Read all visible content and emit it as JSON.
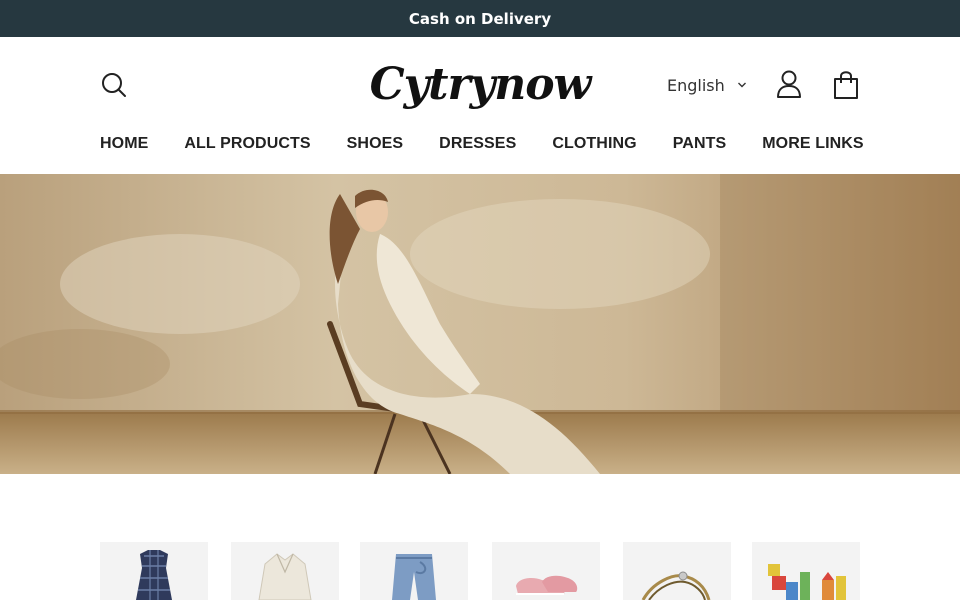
{
  "announcement": {
    "text": "Cash on Delivery"
  },
  "header": {
    "logo_text": "Cytrynow",
    "language": "English",
    "icons": {
      "search": "search-icon",
      "account": "user-icon",
      "cart": "shopping-bag-icon",
      "dropdown": "chevron-down-icon"
    }
  },
  "nav": {
    "items": [
      "HOME",
      "ALL PRODUCTS",
      "SHOES",
      "DRESSES",
      "CLOTHING",
      "PANTS",
      "MORE LINKS"
    ]
  },
  "hero": {
    "image": "hero-banner-image"
  },
  "categories": {
    "tiles": [
      "plaid-dress-image",
      "white-blouse-image",
      "jeans-image",
      "pink-sneakers-image",
      "bracelet-image",
      "building-blocks-image"
    ]
  },
  "colors": {
    "announcement_bg": "#263840",
    "text": "#222222",
    "hero_wall": "#c9b595"
  }
}
